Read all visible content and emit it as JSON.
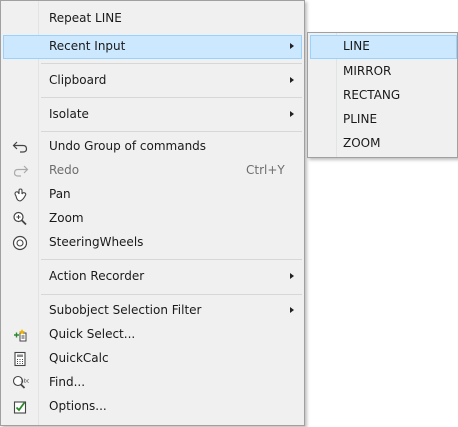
{
  "context_menu": {
    "items": [
      {
        "label": "Repeat LINE"
      },
      {
        "label": "Recent Input"
      },
      {
        "label": "Clipboard"
      },
      {
        "label": "Isolate"
      },
      {
        "label": "Undo Group of commands"
      },
      {
        "label": "Redo",
        "shortcut": "Ctrl+Y"
      },
      {
        "label": "Pan"
      },
      {
        "label": "Zoom"
      },
      {
        "label": "SteeringWheels"
      },
      {
        "label": "Action Recorder"
      },
      {
        "label": "Subobject Selection Filter"
      },
      {
        "label": "Quick Select..."
      },
      {
        "label": "QuickCalc"
      },
      {
        "label": "Find..."
      },
      {
        "label": "Options..."
      }
    ]
  },
  "recent_input_submenu": {
    "items": [
      {
        "label": "LINE"
      },
      {
        "label": "MIRROR"
      },
      {
        "label": "RECTANG"
      },
      {
        "label": "PLINE"
      },
      {
        "label": "ZOOM"
      }
    ]
  },
  "colors": {
    "menu_background": "#f0f0f0",
    "highlight_fill": "#cce8ff",
    "highlight_border": "#99d1ff",
    "disabled_text": "#6d6d6d"
  }
}
